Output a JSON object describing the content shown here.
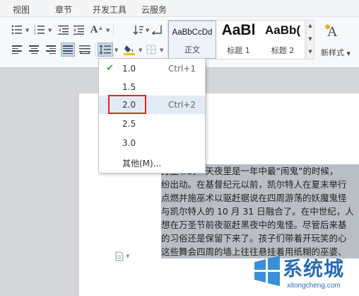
{
  "menu": {
    "tabs": [
      "视图",
      "章节",
      "开发工具",
      "云服务"
    ]
  },
  "ribbon": {
    "styles": [
      {
        "preview": "AaBbCcDd",
        "caption": "正文"
      },
      {
        "preview": "AaBl",
        "caption": "标题 1"
      },
      {
        "preview": "AaBb(",
        "caption": "标题 2"
      }
    ],
    "new_style_label": "新样式",
    "new_style_glyph": "A",
    "font_grow_glyph": "A",
    "icons": [
      "bullet-list-icon",
      "numbered-list-icon",
      "decrease-indent-icon",
      "increase-indent-icon",
      "font-size-icon",
      "sort-icon",
      "show-marks-icon",
      "align-left-icon",
      "align-center-icon",
      "align-right-icon",
      "justify-icon",
      "distribute-icon",
      "line-spacing-icon",
      "shading-icon",
      "border-icon"
    ]
  },
  "line_spacing_menu": {
    "items": [
      {
        "value": "1.0",
        "shortcut": "Ctrl+1",
        "checked": true
      },
      {
        "value": "1.5",
        "shortcut": "",
        "checked": false
      },
      {
        "value": "2.0",
        "shortcut": "Ctrl+2",
        "checked": false
      },
      {
        "value": "2.5",
        "shortcut": "",
        "checked": false
      },
      {
        "value": "3.0",
        "shortcut": "",
        "checked": false
      },
      {
        "value": "其他(M)...",
        "shortcut": "",
        "checked": false
      }
    ],
    "highlighted_value": "2.0"
  },
  "document": {
    "lines": [
      "万圣节的一天夜里是一年中最“闹鬼”的时候，",
      "纷出动。在基督纪元以前，凯尔特人在夏末举行",
      "点燃并施巫术以驱赶据说在四周游荡的妖魔鬼怪",
      "与凯尔特人的 10 月 31 日融合了。在中世纪，人",
      "想在万圣节前夜驱赶黑夜中的鬼怪。尽管后来基",
      "的习俗还是保留下来了。孩子们带着开玩笑的心",
      "这些舞会四周的墙上往往悬挂着用纸糊的巫婆、"
    ]
  },
  "watermark": {
    "title": "系统城",
    "subtitle": "xitongcheng.com"
  }
}
